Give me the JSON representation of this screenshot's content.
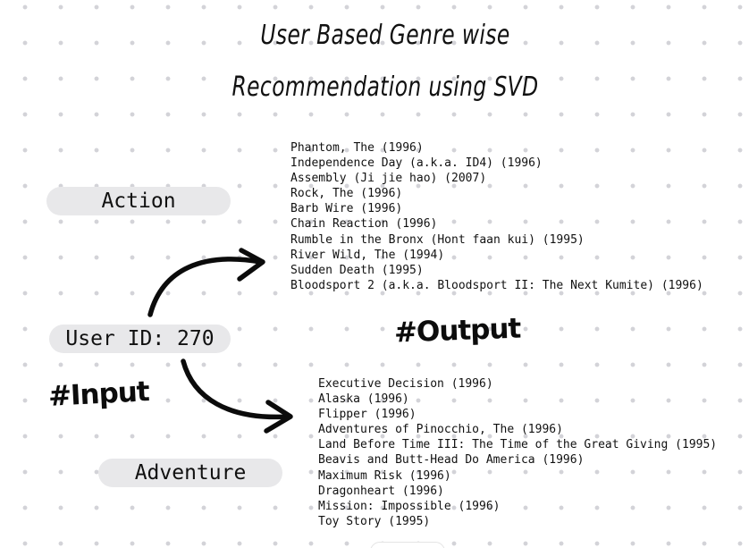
{
  "title": {
    "line1": "User Based Genre wise",
    "line2": "Recommendation using SVD"
  },
  "input": {
    "tag": "#Input",
    "user_label": "User ID: 270"
  },
  "output": {
    "tag": "#Output"
  },
  "genres": [
    {
      "name": "Action",
      "recommendations": [
        "Phantom, The (1996)",
        "Independence Day (a.k.a. ID4) (1996)",
        "Assembly (Ji jie hao) (2007)",
        "Rock, The (1996)",
        "Barb Wire (1996)",
        "Chain Reaction (1996)",
        "Rumble in the Bronx (Hont faan kui) (1995)",
        "River Wild, The (1994)",
        "Sudden Death (1995)",
        "Bloodsport 2 (a.k.a. Bloodsport II: The Next Kumite) (1996)"
      ]
    },
    {
      "name": "Adventure",
      "recommendations": [
        "Executive Decision (1996)",
        "Alaska (1996)",
        "Flipper (1996)",
        "Adventures of Pinocchio, The (1996)",
        "Land Before Time III: The Time of the Great Giving (1995)",
        "Beavis and Butt-Head Do America (1996)",
        "Maximum Risk (1996)",
        "Dragonheart (1996)",
        "Mission: Impossible (1996)",
        "Toy Story (1995)"
      ]
    }
  ],
  "colors": {
    "background": "#ffffff",
    "dot_grid": "#d3d3d8",
    "pill": "#e8e8ea",
    "ink": "#111111"
  },
  "icons": {
    "arrow_to_action": "curved-arrow-icon",
    "arrow_to_adventure": "curved-arrow-icon"
  }
}
